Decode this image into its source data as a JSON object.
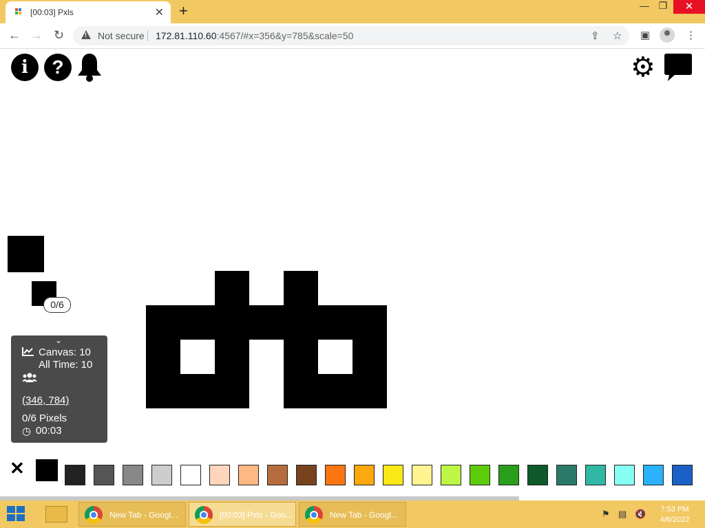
{
  "browser": {
    "tab_title": "[00:03] Pxls",
    "address_warning": "Not secure",
    "url_host": "172.81.110.60",
    "url_rest": ":4567/#x=356&y=785&scale=50"
  },
  "canvas_overlay": {
    "cooldown_bubble": "0/6"
  },
  "info_panel": {
    "canvas_label": "Canvas: 10",
    "alltime_label": "All Time: 10",
    "coords": "(346, 784)",
    "pixels": "0/6 Pixels",
    "timer": "00:03"
  },
  "palette": {
    "close_glyph": "✕",
    "selected_color": "#000000",
    "colors": [
      "#222222",
      "#555555",
      "#888888",
      "#cdcdcd",
      "#ffffff",
      "#ffd5bc",
      "#ffb783",
      "#b66d3d",
      "#77431f",
      "#fc7510",
      "#fca80e",
      "#fde817",
      "#fff491",
      "#bef646",
      "#5dcc0b",
      "#299e1a",
      "#0e5a2b",
      "#2a7a6a",
      "#30b8a5",
      "#88fff3",
      "#2ab2fb",
      "#1a60c7"
    ]
  },
  "taskbar": {
    "apps": [
      {
        "label": "New Tab - Googl..."
      },
      {
        "label": "[00:03] Pxls - Goo..."
      },
      {
        "label": "New Tab - Googl..."
      }
    ],
    "time": "7:53 PM",
    "date": "4/6/2022"
  }
}
